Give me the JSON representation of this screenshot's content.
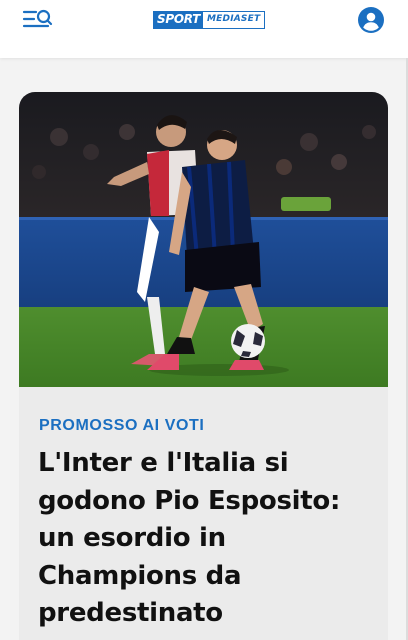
{
  "header": {
    "logo": {
      "word1": "SPORT",
      "word2": "MEDIASET"
    },
    "icons": {
      "menu": "menu-search-icon",
      "user": "user-account-icon"
    }
  },
  "article": {
    "kicker": "PROMOSSO AI VOTI",
    "headline": "L'Inter e l'Italia si godono Pio Esposito: un esordio in Champions da predestinato",
    "image": "match-photo"
  },
  "colors": {
    "brand": "#1b6fc1",
    "header_bg": "#ffffff",
    "page_bg": "#f3f3f3",
    "card_bg": "#ebebeb",
    "headline": "#111111"
  }
}
